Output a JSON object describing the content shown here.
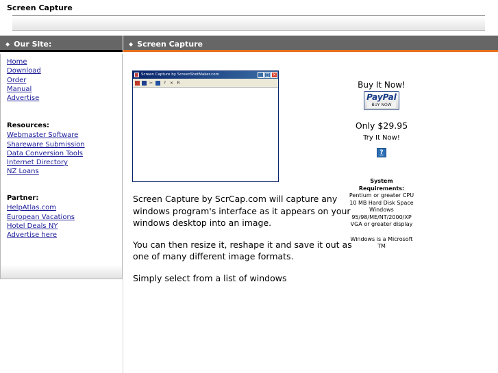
{
  "header": {
    "title": "Screen Capture"
  },
  "sidebar": {
    "heading": "Our Site:",
    "site_links": [
      "Home",
      "Download",
      "Order",
      "Manual",
      "Advertise"
    ],
    "resources": {
      "title": "Resources:",
      "links": [
        "Webmaster Software",
        "Shareware Submission",
        "Data Conversion Tools",
        "Internet Directory",
        "NZ Loans"
      ]
    },
    "partner": {
      "title": "Partner:",
      "links": [
        "HelpAtlas.com",
        "European Vacations",
        "Hotel Deals NY",
        "Advertise here"
      ]
    }
  },
  "main": {
    "heading": "Screen Capture",
    "screenshot_window": {
      "title": "Screen Capture by ScreenShotMaker.com",
      "toolbar_icons": [
        "palette-icon",
        "save-icon",
        "crop-icon",
        "print-icon",
        "help-icon",
        "close-icon",
        "resize-icon"
      ]
    },
    "paragraphs": [
      "Screen Capture by ScrCap.com will capture any windows program's interface as it appears on your windows desktop into an image.",
      "You can then resize it, reshape it and save it out as one of many different image formats.",
      "Simply select from a list of windows"
    ]
  },
  "purchase": {
    "buy_label": "Buy It Now!",
    "paypal_logo": "PayPal",
    "paypal_sub": "BUY NOW",
    "price": "Only $29.95",
    "try_label": "Try It Now!",
    "help_glyph": "?"
  },
  "requirements": {
    "title": "System Requirements:",
    "items": [
      "Pentium or greater CPU",
      "10 MB Hard Disk Space",
      "Windows 95/98/ME/NT/2000/XP",
      "VGA or greater display"
    ],
    "note": "Windows is a Microsoft TM"
  },
  "colors": {
    "header_bar": "#666666",
    "accent": "#e8701a",
    "link": "#1a1a99"
  }
}
